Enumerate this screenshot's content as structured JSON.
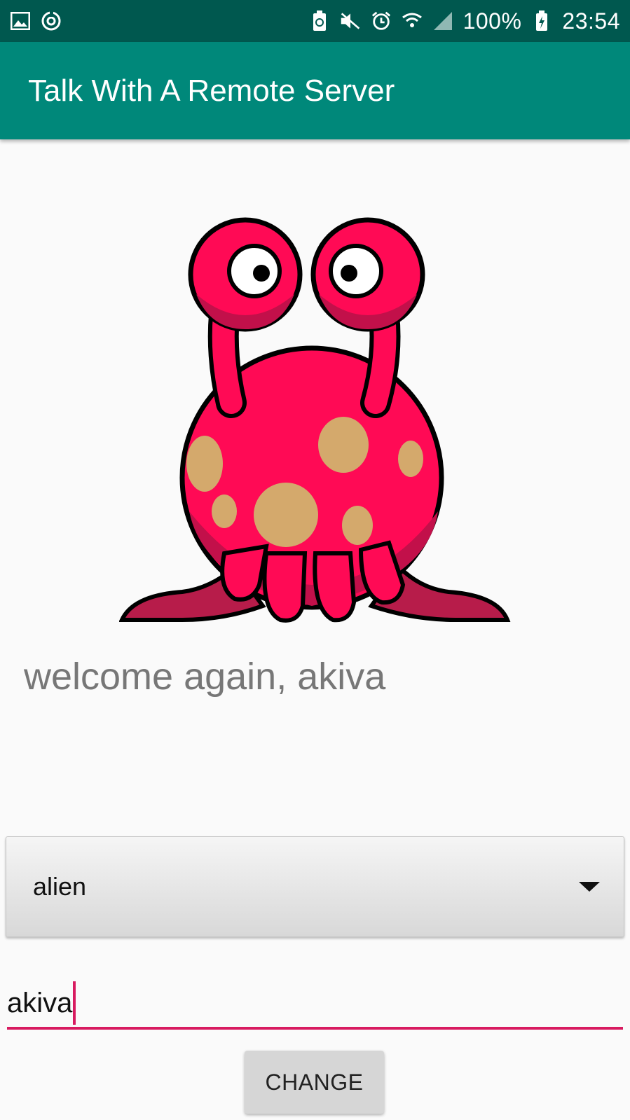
{
  "status_bar": {
    "left_icons": [
      "image-icon",
      "sync-icon"
    ],
    "right_icons": [
      "battery-saver-icon",
      "mute-icon",
      "alarm-icon",
      "wifi-icon",
      "signal-icon",
      "battery-charging-icon"
    ],
    "battery": "100%",
    "time": "23:54"
  },
  "app_bar": {
    "title": "Talk With A Remote Server",
    "color": "#00887a"
  },
  "main": {
    "image_icon": "alien-monster-illustration",
    "welcome_text": "welcome again, akiva"
  },
  "spinner": {
    "selected": "alien",
    "icon": "dropdown-arrow-icon"
  },
  "name_input": {
    "value": "akiva",
    "accent": "#d81b60"
  },
  "change_button": {
    "label": "CHANGE"
  }
}
